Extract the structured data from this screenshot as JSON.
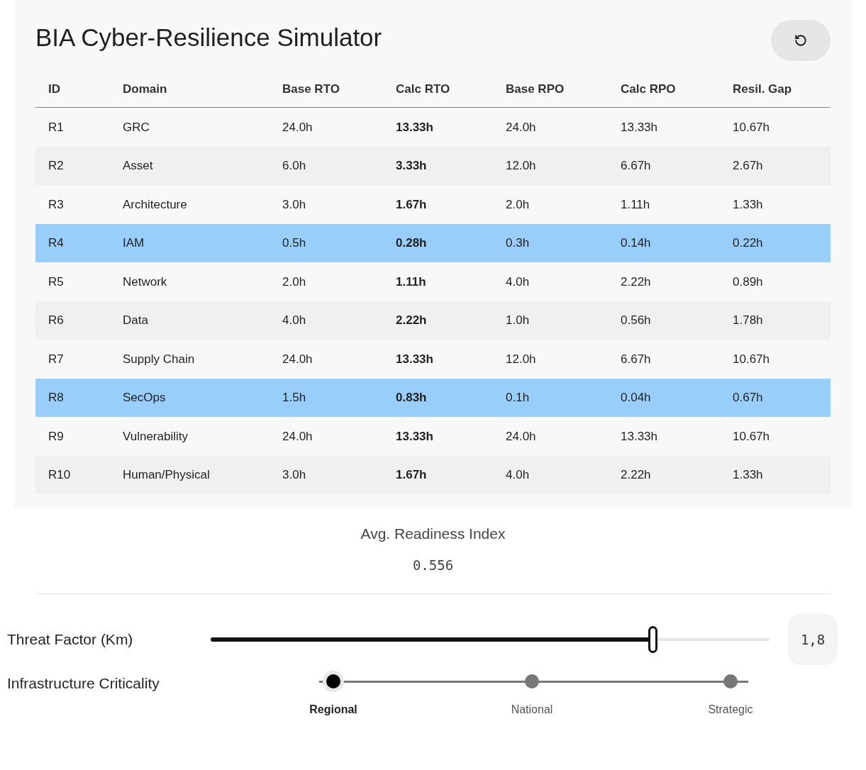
{
  "title": "BIA Cyber-Resilience Simulator",
  "table": {
    "columns": [
      "ID",
      "Domain",
      "Base RTO",
      "Calc RTO",
      "Base RPO",
      "Calc RPO",
      "Resil. Gap"
    ],
    "rows": [
      {
        "cells": [
          "R1",
          "GRC",
          "24.0h",
          "13.33h",
          "24.0h",
          "13.33h",
          "10.67h"
        ],
        "selected": false
      },
      {
        "cells": [
          "R2",
          "Asset",
          "6.0h",
          "3.33h",
          "12.0h",
          "6.67h",
          "2.67h"
        ],
        "selected": false
      },
      {
        "cells": [
          "R3",
          "Architecture",
          "3.0h",
          "1.67h",
          "2.0h",
          "1.11h",
          "1.33h"
        ],
        "selected": false
      },
      {
        "cells": [
          "R4",
          "IAM",
          "0.5h",
          "0.28h",
          "0.3h",
          "0.14h",
          "0.22h"
        ],
        "selected": true
      },
      {
        "cells": [
          "R5",
          "Network",
          "2.0h",
          "1.11h",
          "4.0h",
          "2.22h",
          "0.89h"
        ],
        "selected": false
      },
      {
        "cells": [
          "R6",
          "Data",
          "4.0h",
          "2.22h",
          "1.0h",
          "0.56h",
          "1.78h"
        ],
        "selected": false
      },
      {
        "cells": [
          "R7",
          "Supply Chain",
          "24.0h",
          "13.33h",
          "12.0h",
          "6.67h",
          "10.67h"
        ],
        "selected": false
      },
      {
        "cells": [
          "R8",
          "SecOps",
          "1.5h",
          "0.83h",
          "0.1h",
          "0.04h",
          "0.67h"
        ],
        "selected": true
      },
      {
        "cells": [
          "R9",
          "Vulnerability",
          "24.0h",
          "13.33h",
          "24.0h",
          "13.33h",
          "10.67h"
        ],
        "selected": false
      },
      {
        "cells": [
          "R10",
          "Human/Physical",
          "3.0h",
          "1.67h",
          "4.0h",
          "2.22h",
          "1.33h"
        ],
        "selected": false
      }
    ]
  },
  "readiness": {
    "label": "Avg. Readiness Index",
    "value": "0.556"
  },
  "threat": {
    "label": "Threat Factor (Km)",
    "level": 0.79,
    "value": "1,8"
  },
  "criticality": {
    "label": "Infrastructure Criticality",
    "options": [
      {
        "label": "Regional",
        "selected": true
      },
      {
        "label": "National",
        "selected": false
      },
      {
        "label": "Strategic",
        "selected": false
      }
    ]
  }
}
